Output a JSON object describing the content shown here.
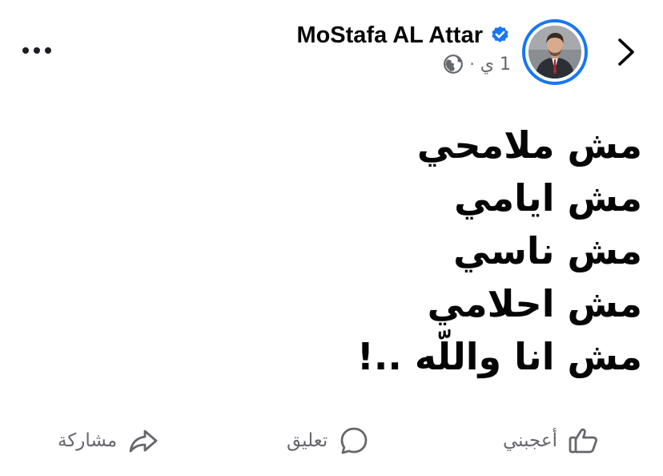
{
  "header": {
    "author_name": "MoStafa AL Attar",
    "verified_icon": "verified-badge-icon",
    "time": "1 ي",
    "separator": "·",
    "audience_icon": "globe-icon",
    "more_icon": "more-options-icon",
    "back_icon": "chevron-icon",
    "avatar_ring_color": "#1877f2"
  },
  "post": {
    "lines": [
      "مش ملامحي",
      "مش ايامي",
      "مش ناسي",
      "مش احلامي",
      "مش انا واللّه ..!"
    ]
  },
  "actions": {
    "like_label": "أعجبني",
    "comment_label": "تعليق",
    "share_label": "مشاركة",
    "like_icon": "thumbs-up-icon",
    "comment_icon": "comment-bubble-icon",
    "share_icon": "share-arrow-icon"
  },
  "colors": {
    "text": "#050505",
    "secondary": "#65676b",
    "accent": "#1877f2"
  }
}
